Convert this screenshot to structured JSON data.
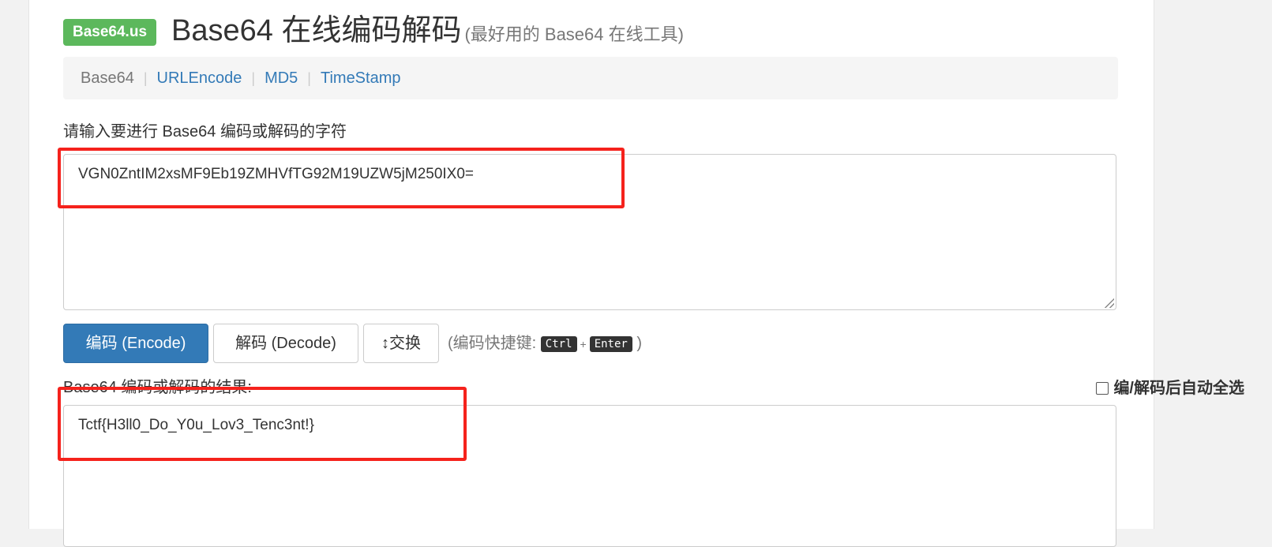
{
  "header": {
    "brand": "Base64.us",
    "title": "Base64 在线编码解码",
    "subtitle": "(最好用的 Base64 在线工具)"
  },
  "nav": {
    "items": [
      {
        "label": "Base64"
      },
      {
        "label": "URLEncode"
      },
      {
        "label": "MD5"
      },
      {
        "label": "TimeStamp"
      }
    ],
    "separator": "|"
  },
  "input": {
    "label": "请输入要进行 Base64 编码或解码的字符",
    "value": "VGN0ZntIM2xsMF9Eb19ZMHVfTG92M19UZW5jM250IX0="
  },
  "buttons": {
    "encode": "编码 (Encode)",
    "decode": "解码 (Decode)",
    "swap_icon": "↕",
    "swap": "交换"
  },
  "hint": {
    "prefix": "(编码快捷键:",
    "key1": "Ctrl",
    "plus": "+",
    "key2": "Enter",
    "suffix": ")"
  },
  "output": {
    "label": "Base64 编码或解码的结果:",
    "autoselect_label": "编/解码后自动全选",
    "autoselect_checked": false,
    "value": "Tctf{H3ll0_Do_Y0u_Lov3_Tenc3nt!}"
  },
  "annotation": {
    "highlight_color": "#f5221c"
  }
}
